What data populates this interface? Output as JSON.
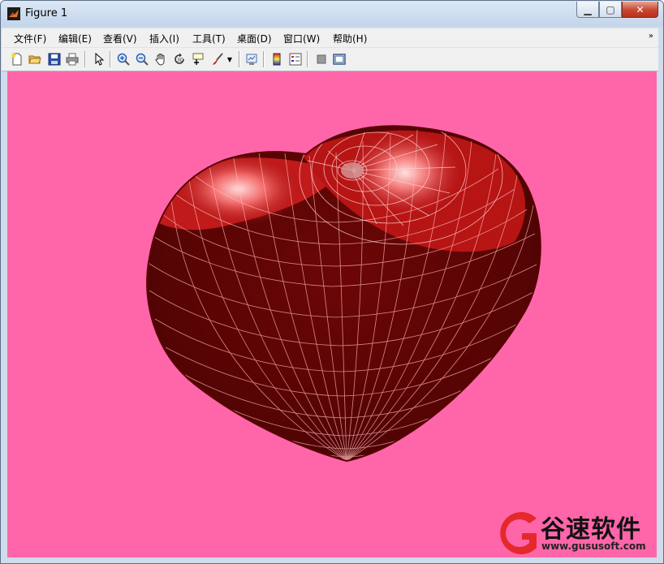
{
  "window": {
    "title": "Figure 1"
  },
  "menu": [
    {
      "label": "文件(F)"
    },
    {
      "label": "编辑(E)"
    },
    {
      "label": "查看(V)"
    },
    {
      "label": "插入(I)"
    },
    {
      "label": "工具(T)"
    },
    {
      "label": "桌面(D)"
    },
    {
      "label": "窗口(W)"
    },
    {
      "label": "帮助(H)"
    }
  ],
  "menu_overflow_icon": "double-chevron-icon",
  "toolbar": {
    "tools": [
      "new-figure",
      "open-file",
      "save-figure",
      "print-figure",
      "edit-plot",
      "zoom-in",
      "zoom-out",
      "pan",
      "rotate-3d",
      "data-cursor",
      "brush",
      "link-plot",
      "colorbar",
      "legend",
      "hide-plot-tools",
      "show-plot-tools"
    ]
  },
  "figure": {
    "background": "#ff66aa",
    "surface_color": "#8b0a0a",
    "mesh_color": "#ffc0c0"
  },
  "watermark": {
    "title": "谷速软件",
    "url": "www.gususoft.com",
    "logo_color": "#e5282a"
  }
}
